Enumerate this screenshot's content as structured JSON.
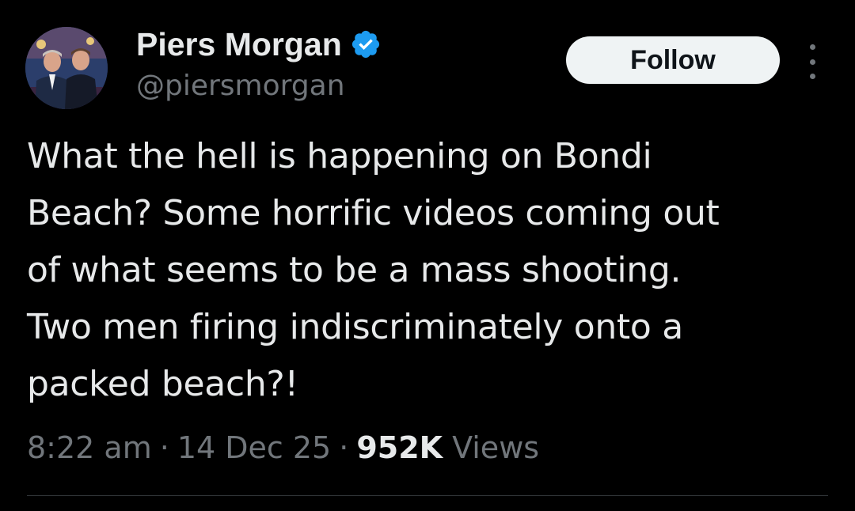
{
  "author": {
    "display_name": "Piers Morgan",
    "handle": "@piersmorgan",
    "verified": true
  },
  "actions": {
    "follow_label": "Follow"
  },
  "tweet": {
    "text": "What the hell is happening on Bondi\nBeach? Some horrific videos coming out\nof what seems to be a mass shooting.\nTwo men firing indiscriminately onto a\npacked beach?!"
  },
  "meta": {
    "time": "8:22 am",
    "separator": "·",
    "date": "14 Dec 25",
    "views_count": "952K",
    "views_label": "Views"
  },
  "icons": {
    "verified": "verified-badge-icon",
    "more": "more-options-icon",
    "avatar": "profile-photo"
  },
  "colors": {
    "background": "#000000",
    "primary_text": "#e7e9ea",
    "secondary_text": "#71767b",
    "verified_blue": "#1d9bf0",
    "follow_bg": "#eff3f4",
    "follow_text": "#0f1419"
  }
}
